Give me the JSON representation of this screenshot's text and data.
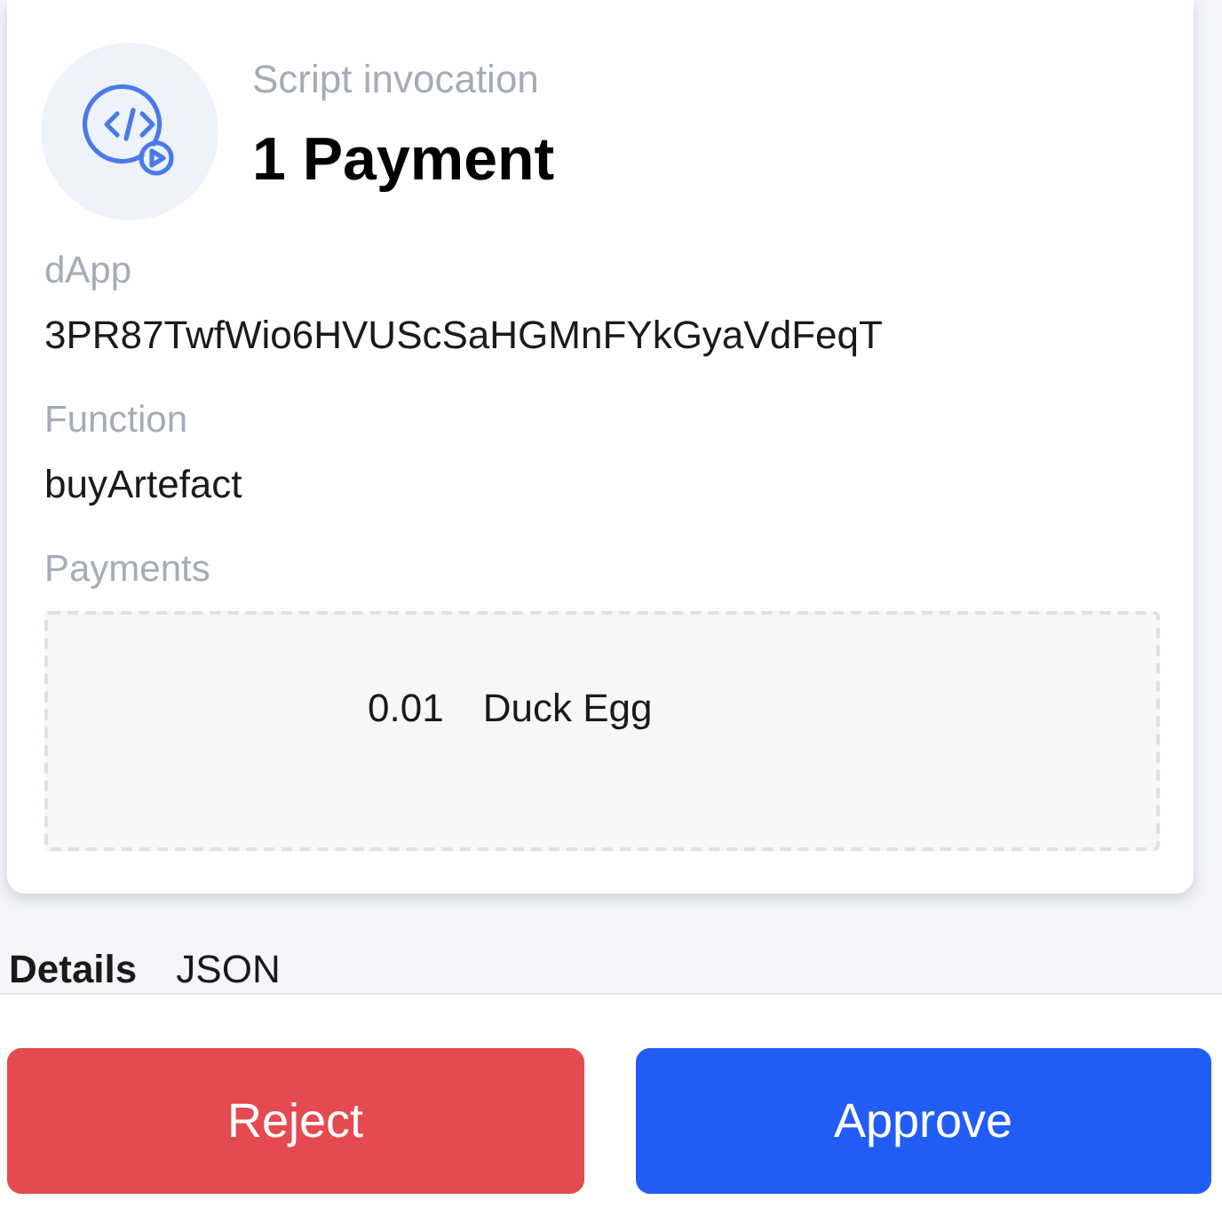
{
  "header": {
    "subtitle": "Script invocation",
    "title": "1 Payment"
  },
  "fields": [
    {
      "label": "dApp",
      "value": "3PR87TwfWio6HVUScSaHGMnFYkGyaVdFeqT"
    },
    {
      "label": "Function",
      "value": "buyArtefact"
    }
  ],
  "payments": {
    "label": "Payments",
    "items": [
      {
        "amount": "0.01",
        "asset": "Duck Egg"
      }
    ]
  },
  "tabs": [
    {
      "label": "Details",
      "selected": true
    },
    {
      "label": "JSON",
      "selected": false
    }
  ],
  "buttons": [
    {
      "label": "Reject",
      "kind": "reject"
    },
    {
      "label": "Approve",
      "kind": "approve"
    }
  ]
}
